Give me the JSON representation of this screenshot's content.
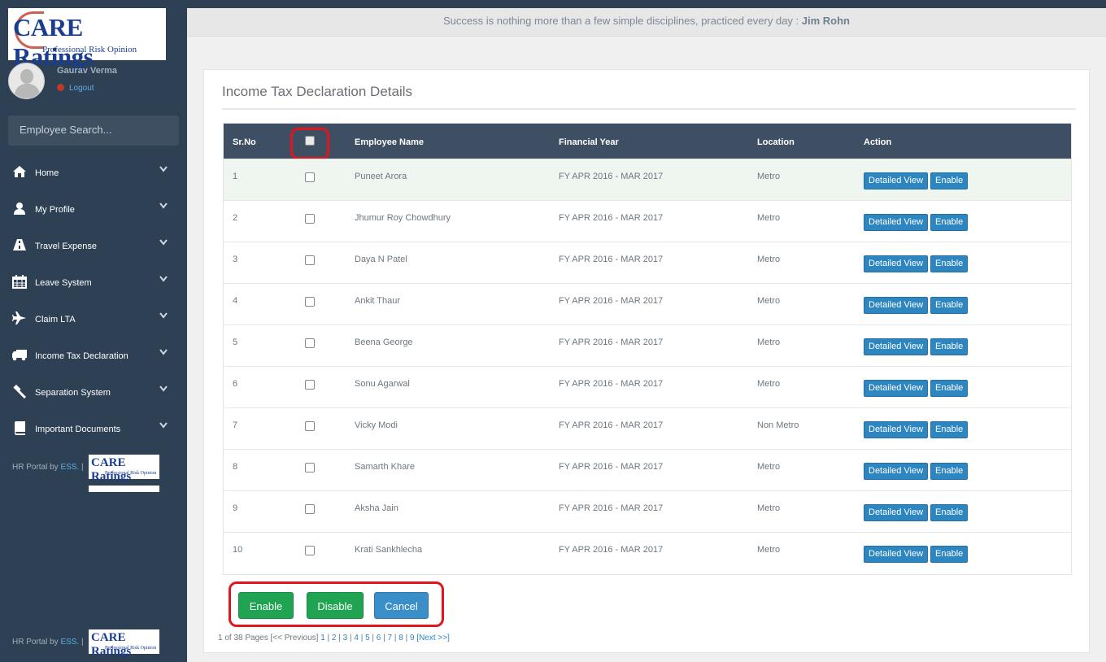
{
  "brand": {
    "name": "CARE Ratings",
    "tagline": "Professional Risk Opinion"
  },
  "user": {
    "name": "Gaurav Verma",
    "logout_label": "Logout"
  },
  "search": {
    "placeholder": "Employee Search..."
  },
  "nav": [
    {
      "label": "Home",
      "icon": "home-icon"
    },
    {
      "label": "My Profile",
      "icon": "user-icon"
    },
    {
      "label": "Travel Expense",
      "icon": "road-icon"
    },
    {
      "label": "Leave System",
      "icon": "calendar-icon"
    },
    {
      "label": "Claim LTA",
      "icon": "plane-icon"
    },
    {
      "label": "Income Tax Declaration",
      "icon": "truck-icon"
    },
    {
      "label": "Separation System",
      "icon": "gavel-icon"
    },
    {
      "label": "Important Documents",
      "icon": "book-icon"
    }
  ],
  "footer": {
    "prefix": "HR Portal by ",
    "ess": "ESS.",
    "sep": " |"
  },
  "quote": {
    "text": "Success is nothing more than a few simple disciplines, practiced every day : ",
    "author": "Jim Rohn"
  },
  "panel": {
    "title": "Income Tax Declaration Details"
  },
  "table": {
    "headers": {
      "srno": "Sr.No",
      "name": "Employee Name",
      "year": "Financial Year",
      "location": "Location",
      "action": "Action"
    },
    "rows": [
      {
        "sr": "1",
        "name": "Puneet Arora",
        "year": "FY APR 2016 - MAR 2017",
        "location": "Metro"
      },
      {
        "sr": "2",
        "name": "Jhumur Roy Chowdhury",
        "year": "FY APR 2016 - MAR 2017",
        "location": "Metro"
      },
      {
        "sr": "3",
        "name": "Daya N Patel",
        "year": "FY APR 2016 - MAR 2017",
        "location": "Metro"
      },
      {
        "sr": "4",
        "name": "Ankit Thaur",
        "year": "FY APR 2016 - MAR 2017",
        "location": "Metro"
      },
      {
        "sr": "5",
        "name": "Beena George",
        "year": "FY APR 2016 - MAR 2017",
        "location": "Metro"
      },
      {
        "sr": "6",
        "name": "Sonu Agarwal",
        "year": "FY APR 2016 - MAR 2017",
        "location": "Metro"
      },
      {
        "sr": "7",
        "name": "Vicky Modi",
        "year": "FY APR 2016 - MAR 2017",
        "location": "Non Metro"
      },
      {
        "sr": "8",
        "name": "Samarth Khare",
        "year": "FY APR 2016 - MAR 2017",
        "location": "Metro"
      },
      {
        "sr": "9",
        "name": "Aksha Jain",
        "year": "FY APR 2016 - MAR 2017",
        "location": "Metro"
      },
      {
        "sr": "10",
        "name": "Krati Sankhlecha",
        "year": "FY APR 2016 - MAR 2017",
        "location": "Metro"
      }
    ],
    "detailed_view_label": "Detailed View",
    "enable_label": "Enable"
  },
  "actions": {
    "enable": "Enable",
    "disable": "Disable",
    "cancel": "Cancel"
  },
  "pager": {
    "summary": "1 of 38 Pages ",
    "prev": "[<< Previous]",
    "pages": [
      "1",
      "2",
      "3",
      "4",
      "5",
      "6",
      "7",
      "8",
      "9"
    ],
    "next": "[Next >>]"
  },
  "colors": {
    "sidebar": "#2e4053",
    "header": "#3e4f63",
    "accent_blue": "#2e86c1",
    "accent_green": "#20a452",
    "highlight_red": "#e0161c"
  }
}
